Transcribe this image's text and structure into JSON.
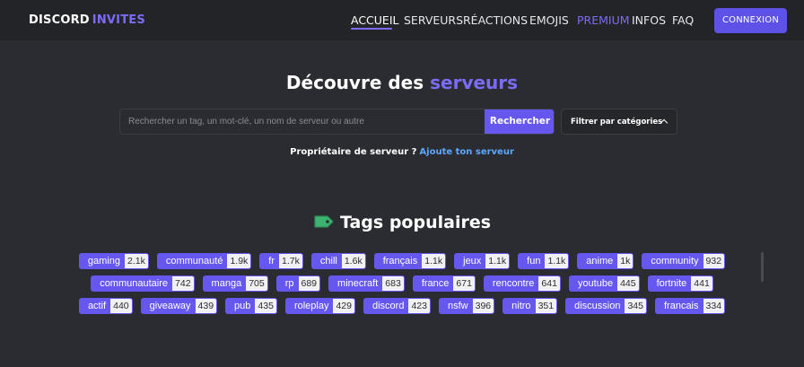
{
  "header": {
    "logo_part1": "DISCORD",
    "logo_part2": "INVITES",
    "nav": [
      {
        "label": "ACCUEIL"
      },
      {
        "label": "SERVEURS"
      },
      {
        "label": "RÉACTIONS"
      },
      {
        "label": "EMOJIS"
      },
      {
        "label": "PREMIUM"
      },
      {
        "label": "INFOS"
      },
      {
        "label": "FAQ"
      }
    ],
    "login_label": "CONNEXION"
  },
  "hero": {
    "title_part1": "Découvre des",
    "title_part2": "serveurs",
    "search_placeholder": "Rechercher un tag, un mot-clé, un nom de serveur ou autre",
    "search_button": "Rechercher",
    "filter_label": "Filtrer par catégories",
    "owner_question": "Propriétaire de serveur ?",
    "owner_link": "Ajoute ton serveur"
  },
  "tags": {
    "title": "Tags populaires",
    "rows": [
      [
        {
          "name": "gaming",
          "count": "2.1k"
        },
        {
          "name": "communauté",
          "count": "1.9k"
        },
        {
          "name": "fr",
          "count": "1.7k"
        },
        {
          "name": "chill",
          "count": "1.6k"
        },
        {
          "name": "français",
          "count": "1.1k"
        },
        {
          "name": "jeux",
          "count": "1.1k"
        },
        {
          "name": "fun",
          "count": "1.1k"
        },
        {
          "name": "anime",
          "count": "1k"
        },
        {
          "name": "community",
          "count": "932"
        }
      ],
      [
        {
          "name": "communautaire",
          "count": "742"
        },
        {
          "name": "manga",
          "count": "705"
        },
        {
          "name": "rp",
          "count": "689"
        },
        {
          "name": "minecraft",
          "count": "683"
        },
        {
          "name": "france",
          "count": "671"
        },
        {
          "name": "rencontre",
          "count": "641"
        },
        {
          "name": "youtube",
          "count": "445"
        },
        {
          "name": "fortnite",
          "count": "441"
        }
      ],
      [
        {
          "name": "actif",
          "count": "440"
        },
        {
          "name": "giveaway",
          "count": "439"
        },
        {
          "name": "pub",
          "count": "435"
        },
        {
          "name": "roleplay",
          "count": "429"
        },
        {
          "name": "discord",
          "count": "423"
        },
        {
          "name": "nsfw",
          "count": "396"
        },
        {
          "name": "nitro",
          "count": "351"
        },
        {
          "name": "discussion",
          "count": "345"
        },
        {
          "name": "francais",
          "count": "334"
        }
      ]
    ]
  },
  "colors": {
    "accent": "#7b6cf6",
    "button": "#5d51e8",
    "link": "#5da8ff",
    "background": "#2b2c31"
  }
}
